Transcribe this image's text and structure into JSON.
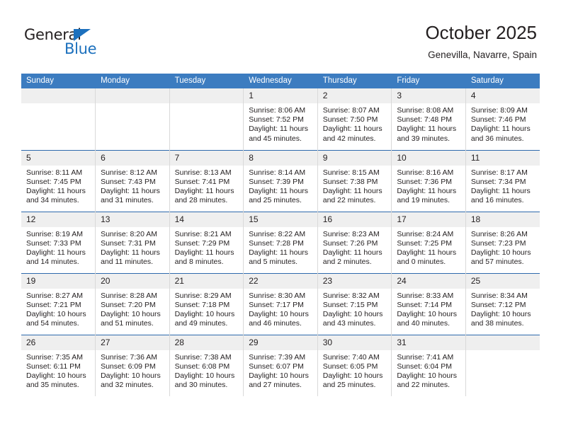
{
  "brand": {
    "name_top": "General",
    "name_bottom": "Blue",
    "accent_color": "#1c70bd",
    "text_color": "#231f20"
  },
  "header": {
    "title": "October 2025",
    "subtitle": "Genevilla, Navarre, Spain"
  },
  "theme": {
    "header_bar_color": "#3c7cc0",
    "row_divider_color": "#2e6aad",
    "daynum_band_color": "#efefef",
    "cell_border_color": "#d9d9d9"
  },
  "weekday_headers": [
    "Sunday",
    "Monday",
    "Tuesday",
    "Wednesday",
    "Thursday",
    "Friday",
    "Saturday"
  ],
  "weeks": [
    [
      {
        "day": "",
        "empty": true
      },
      {
        "day": "",
        "empty": true
      },
      {
        "day": "",
        "empty": true
      },
      {
        "day": "1",
        "sunrise": "Sunrise: 8:06 AM",
        "sunset": "Sunset: 7:52 PM",
        "daylight_1": "Daylight: 11 hours",
        "daylight_2": "and 45 minutes."
      },
      {
        "day": "2",
        "sunrise": "Sunrise: 8:07 AM",
        "sunset": "Sunset: 7:50 PM",
        "daylight_1": "Daylight: 11 hours",
        "daylight_2": "and 42 minutes."
      },
      {
        "day": "3",
        "sunrise": "Sunrise: 8:08 AM",
        "sunset": "Sunset: 7:48 PM",
        "daylight_1": "Daylight: 11 hours",
        "daylight_2": "and 39 minutes."
      },
      {
        "day": "4",
        "sunrise": "Sunrise: 8:09 AM",
        "sunset": "Sunset: 7:46 PM",
        "daylight_1": "Daylight: 11 hours",
        "daylight_2": "and 36 minutes."
      }
    ],
    [
      {
        "day": "5",
        "sunrise": "Sunrise: 8:11 AM",
        "sunset": "Sunset: 7:45 PM",
        "daylight_1": "Daylight: 11 hours",
        "daylight_2": "and 34 minutes."
      },
      {
        "day": "6",
        "sunrise": "Sunrise: 8:12 AM",
        "sunset": "Sunset: 7:43 PM",
        "daylight_1": "Daylight: 11 hours",
        "daylight_2": "and 31 minutes."
      },
      {
        "day": "7",
        "sunrise": "Sunrise: 8:13 AM",
        "sunset": "Sunset: 7:41 PM",
        "daylight_1": "Daylight: 11 hours",
        "daylight_2": "and 28 minutes."
      },
      {
        "day": "8",
        "sunrise": "Sunrise: 8:14 AM",
        "sunset": "Sunset: 7:39 PM",
        "daylight_1": "Daylight: 11 hours",
        "daylight_2": "and 25 minutes."
      },
      {
        "day": "9",
        "sunrise": "Sunrise: 8:15 AM",
        "sunset": "Sunset: 7:38 PM",
        "daylight_1": "Daylight: 11 hours",
        "daylight_2": "and 22 minutes."
      },
      {
        "day": "10",
        "sunrise": "Sunrise: 8:16 AM",
        "sunset": "Sunset: 7:36 PM",
        "daylight_1": "Daylight: 11 hours",
        "daylight_2": "and 19 minutes."
      },
      {
        "day": "11",
        "sunrise": "Sunrise: 8:17 AM",
        "sunset": "Sunset: 7:34 PM",
        "daylight_1": "Daylight: 11 hours",
        "daylight_2": "and 16 minutes."
      }
    ],
    [
      {
        "day": "12",
        "sunrise": "Sunrise: 8:19 AM",
        "sunset": "Sunset: 7:33 PM",
        "daylight_1": "Daylight: 11 hours",
        "daylight_2": "and 14 minutes."
      },
      {
        "day": "13",
        "sunrise": "Sunrise: 8:20 AM",
        "sunset": "Sunset: 7:31 PM",
        "daylight_1": "Daylight: 11 hours",
        "daylight_2": "and 11 minutes."
      },
      {
        "day": "14",
        "sunrise": "Sunrise: 8:21 AM",
        "sunset": "Sunset: 7:29 PM",
        "daylight_1": "Daylight: 11 hours",
        "daylight_2": "and 8 minutes."
      },
      {
        "day": "15",
        "sunrise": "Sunrise: 8:22 AM",
        "sunset": "Sunset: 7:28 PM",
        "daylight_1": "Daylight: 11 hours",
        "daylight_2": "and 5 minutes."
      },
      {
        "day": "16",
        "sunrise": "Sunrise: 8:23 AM",
        "sunset": "Sunset: 7:26 PM",
        "daylight_1": "Daylight: 11 hours",
        "daylight_2": "and 2 minutes."
      },
      {
        "day": "17",
        "sunrise": "Sunrise: 8:24 AM",
        "sunset": "Sunset: 7:25 PM",
        "daylight_1": "Daylight: 11 hours",
        "daylight_2": "and 0 minutes."
      },
      {
        "day": "18",
        "sunrise": "Sunrise: 8:26 AM",
        "sunset": "Sunset: 7:23 PM",
        "daylight_1": "Daylight: 10 hours",
        "daylight_2": "and 57 minutes."
      }
    ],
    [
      {
        "day": "19",
        "sunrise": "Sunrise: 8:27 AM",
        "sunset": "Sunset: 7:21 PM",
        "daylight_1": "Daylight: 10 hours",
        "daylight_2": "and 54 minutes."
      },
      {
        "day": "20",
        "sunrise": "Sunrise: 8:28 AM",
        "sunset": "Sunset: 7:20 PM",
        "daylight_1": "Daylight: 10 hours",
        "daylight_2": "and 51 minutes."
      },
      {
        "day": "21",
        "sunrise": "Sunrise: 8:29 AM",
        "sunset": "Sunset: 7:18 PM",
        "daylight_1": "Daylight: 10 hours",
        "daylight_2": "and 49 minutes."
      },
      {
        "day": "22",
        "sunrise": "Sunrise: 8:30 AM",
        "sunset": "Sunset: 7:17 PM",
        "daylight_1": "Daylight: 10 hours",
        "daylight_2": "and 46 minutes."
      },
      {
        "day": "23",
        "sunrise": "Sunrise: 8:32 AM",
        "sunset": "Sunset: 7:15 PM",
        "daylight_1": "Daylight: 10 hours",
        "daylight_2": "and 43 minutes."
      },
      {
        "day": "24",
        "sunrise": "Sunrise: 8:33 AM",
        "sunset": "Sunset: 7:14 PM",
        "daylight_1": "Daylight: 10 hours",
        "daylight_2": "and 40 minutes."
      },
      {
        "day": "25",
        "sunrise": "Sunrise: 8:34 AM",
        "sunset": "Sunset: 7:12 PM",
        "daylight_1": "Daylight: 10 hours",
        "daylight_2": "and 38 minutes."
      }
    ],
    [
      {
        "day": "26",
        "sunrise": "Sunrise: 7:35 AM",
        "sunset": "Sunset: 6:11 PM",
        "daylight_1": "Daylight: 10 hours",
        "daylight_2": "and 35 minutes."
      },
      {
        "day": "27",
        "sunrise": "Sunrise: 7:36 AM",
        "sunset": "Sunset: 6:09 PM",
        "daylight_1": "Daylight: 10 hours",
        "daylight_2": "and 32 minutes."
      },
      {
        "day": "28",
        "sunrise": "Sunrise: 7:38 AM",
        "sunset": "Sunset: 6:08 PM",
        "daylight_1": "Daylight: 10 hours",
        "daylight_2": "and 30 minutes."
      },
      {
        "day": "29",
        "sunrise": "Sunrise: 7:39 AM",
        "sunset": "Sunset: 6:07 PM",
        "daylight_1": "Daylight: 10 hours",
        "daylight_2": "and 27 minutes."
      },
      {
        "day": "30",
        "sunrise": "Sunrise: 7:40 AM",
        "sunset": "Sunset: 6:05 PM",
        "daylight_1": "Daylight: 10 hours",
        "daylight_2": "and 25 minutes."
      },
      {
        "day": "31",
        "sunrise": "Sunrise: 7:41 AM",
        "sunset": "Sunset: 6:04 PM",
        "daylight_1": "Daylight: 10 hours",
        "daylight_2": "and 22 minutes."
      },
      {
        "day": "",
        "empty": true
      }
    ]
  ]
}
